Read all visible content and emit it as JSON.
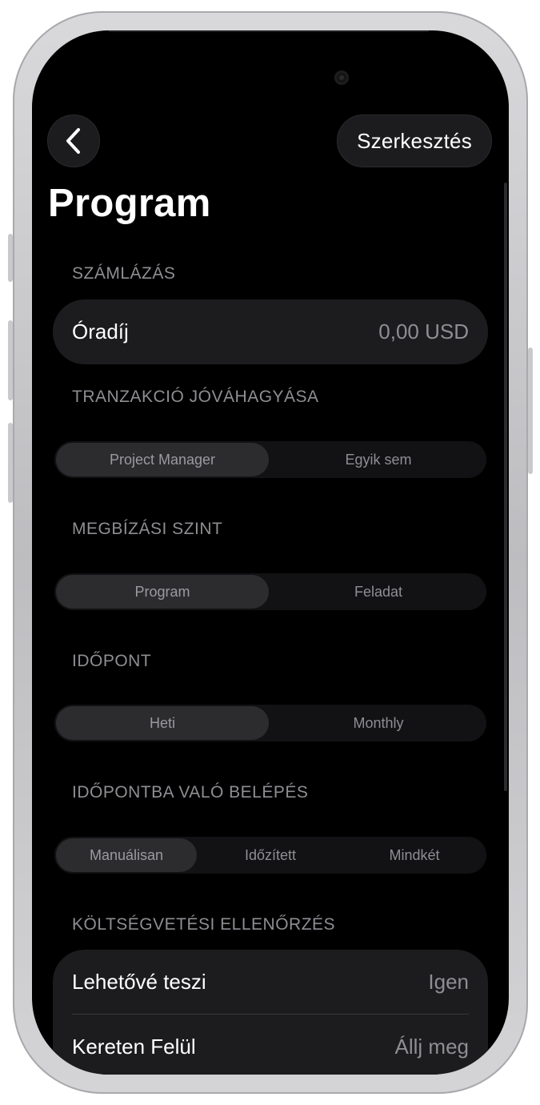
{
  "header": {
    "back_label": "",
    "edit_label": "Szerkesztés",
    "title": "Program"
  },
  "sections": {
    "billing": {
      "label": "SZÁMLÁZÁS",
      "rows": [
        {
          "key": "Óradíj",
          "value": "0,00 USD"
        }
      ]
    },
    "approval": {
      "label": "TRANZAKCIÓ JÓVÁHAGYÁSA",
      "options": [
        "Project Manager",
        "Egyik sem"
      ],
      "selected": "Project Manager"
    },
    "assignment": {
      "label": "MEGBÍZÁSI SZINT",
      "options": [
        "Program",
        "Feladat"
      ],
      "selected": "Program"
    },
    "schedule": {
      "label": "IDŐPONT",
      "options": [
        "Heti",
        "Monthly"
      ],
      "selected": "Heti"
    },
    "entry": {
      "label": "IDŐPONTBA VALÓ BELÉPÉS",
      "options": [
        "Manuálisan",
        "Időzített",
        "Mindkét"
      ],
      "selected": "Manuálisan"
    },
    "budget": {
      "label": "KÖLTSÉGVETÉSI ELLENŐRZÉS",
      "rows": [
        {
          "key": "Lehetővé teszi",
          "value": "Igen"
        },
        {
          "key": "Kereten Felül",
          "value": "Állj meg"
        }
      ]
    }
  },
  "icons": {
    "back": "chevron-left-icon"
  },
  "colors": {
    "background": "#000000",
    "card": "#1c1c1e",
    "secondary_text": "#8e8e93"
  }
}
